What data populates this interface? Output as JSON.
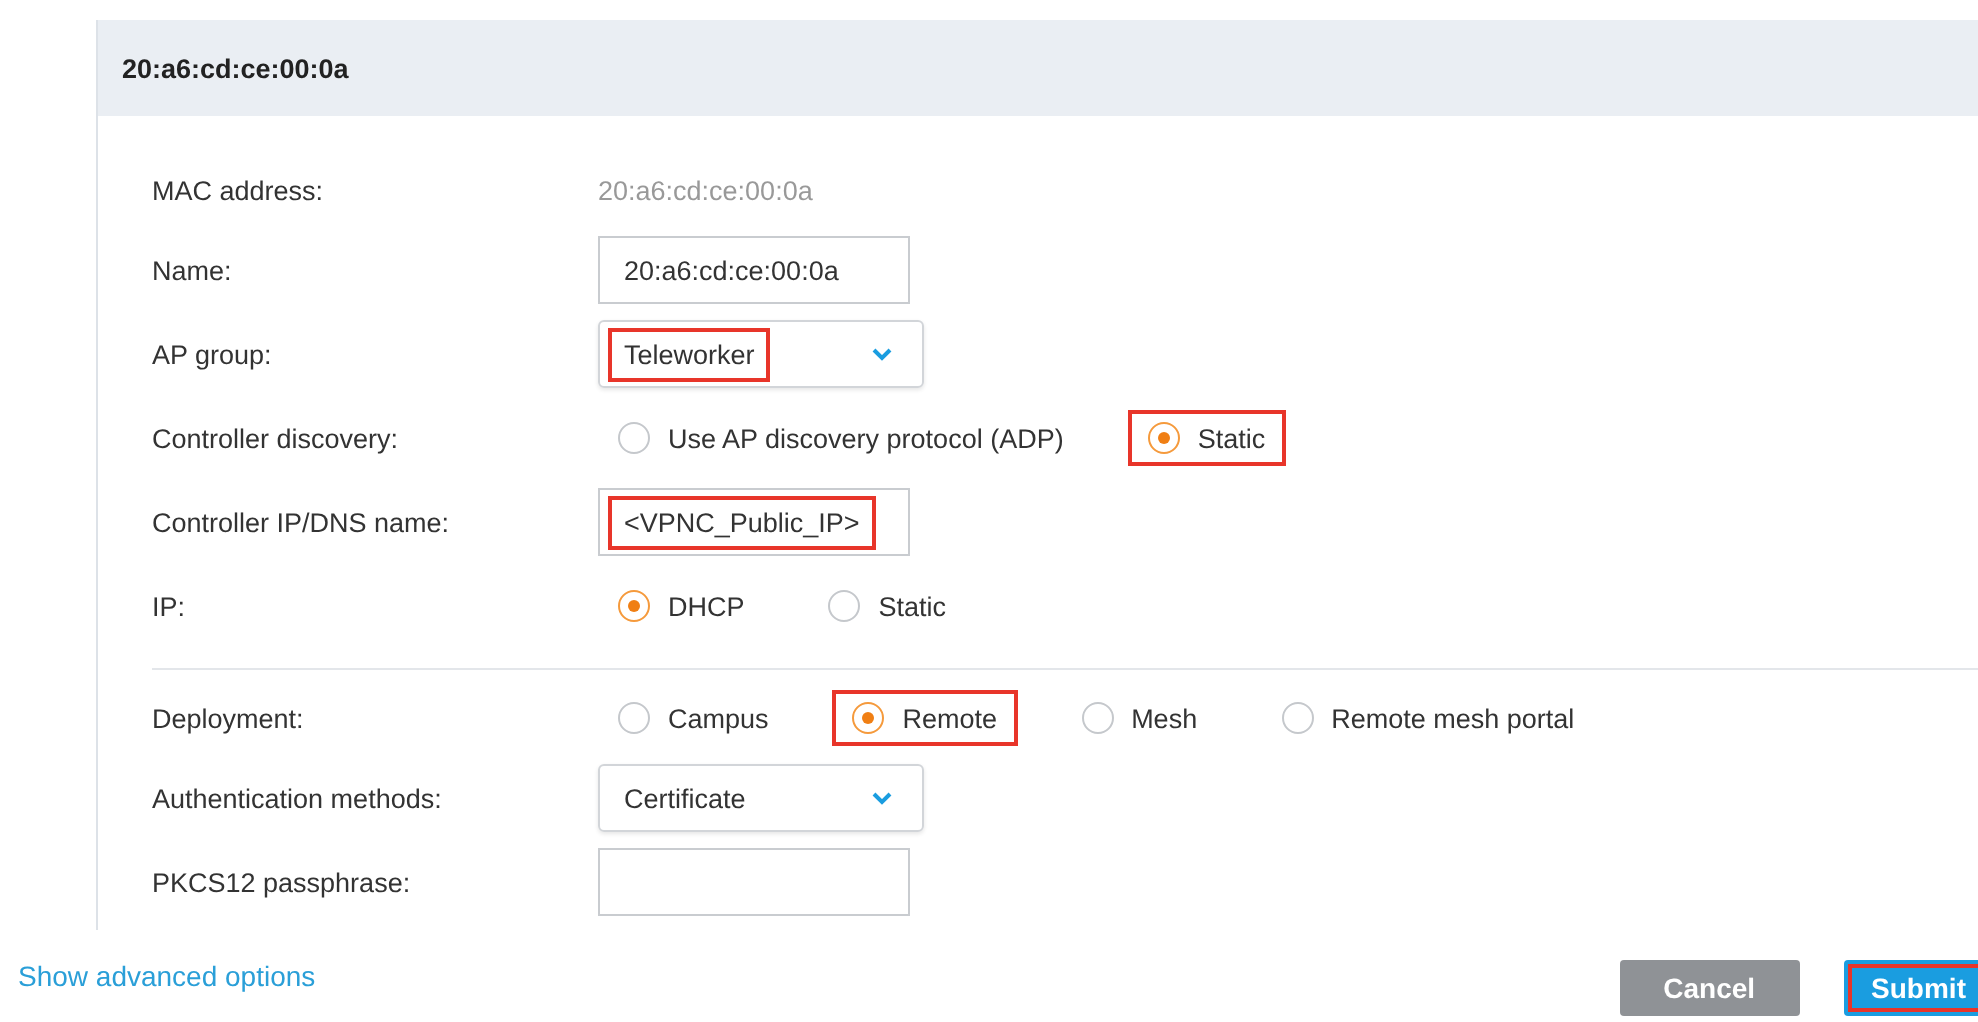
{
  "panel": {
    "title": "20:a6:cd:ce:00:0a"
  },
  "sections": [
    {
      "rows": [
        {
          "label": "MAC address:",
          "kind": "static",
          "value": "20:a6:cd:ce:00:0a"
        },
        {
          "label": "Name:",
          "kind": "input",
          "value": "20:a6:cd:ce:00:0a"
        },
        {
          "label": "AP group:",
          "kind": "select",
          "value": "Teleworker",
          "highlighted": true
        },
        {
          "label": "Controller discovery:",
          "kind": "radio",
          "options": [
            {
              "label": "Use AP discovery protocol (ADP)",
              "selected": false
            },
            {
              "label": "Static",
              "selected": true,
              "highlighted": true
            }
          ]
        },
        {
          "label": "Controller IP/DNS name:",
          "kind": "input",
          "value": "<VPNC_Public_IP>",
          "highlighted": true
        },
        {
          "label": "IP:",
          "kind": "radio",
          "options": [
            {
              "label": "DHCP",
              "selected": true
            },
            {
              "label": "Static",
              "selected": false
            }
          ]
        }
      ]
    },
    {
      "rows": [
        {
          "label": "Deployment:",
          "kind": "radio",
          "options": [
            {
              "label": "Campus",
              "selected": false
            },
            {
              "label": "Remote",
              "selected": true,
              "highlighted": true
            },
            {
              "label": "Mesh",
              "selected": false
            },
            {
              "label": "Remote mesh portal",
              "selected": false
            }
          ]
        },
        {
          "label": "Authentication methods:",
          "kind": "select",
          "value": "Certificate"
        },
        {
          "label": "PKCS12 passphrase:",
          "kind": "input"
        }
      ]
    }
  ],
  "footer": {
    "link": "Show advanced options",
    "buttons": [
      {
        "label": "Cancel",
        "kind": "secondary"
      },
      {
        "label": "Submit",
        "kind": "primary",
        "highlighted": true
      }
    ]
  }
}
